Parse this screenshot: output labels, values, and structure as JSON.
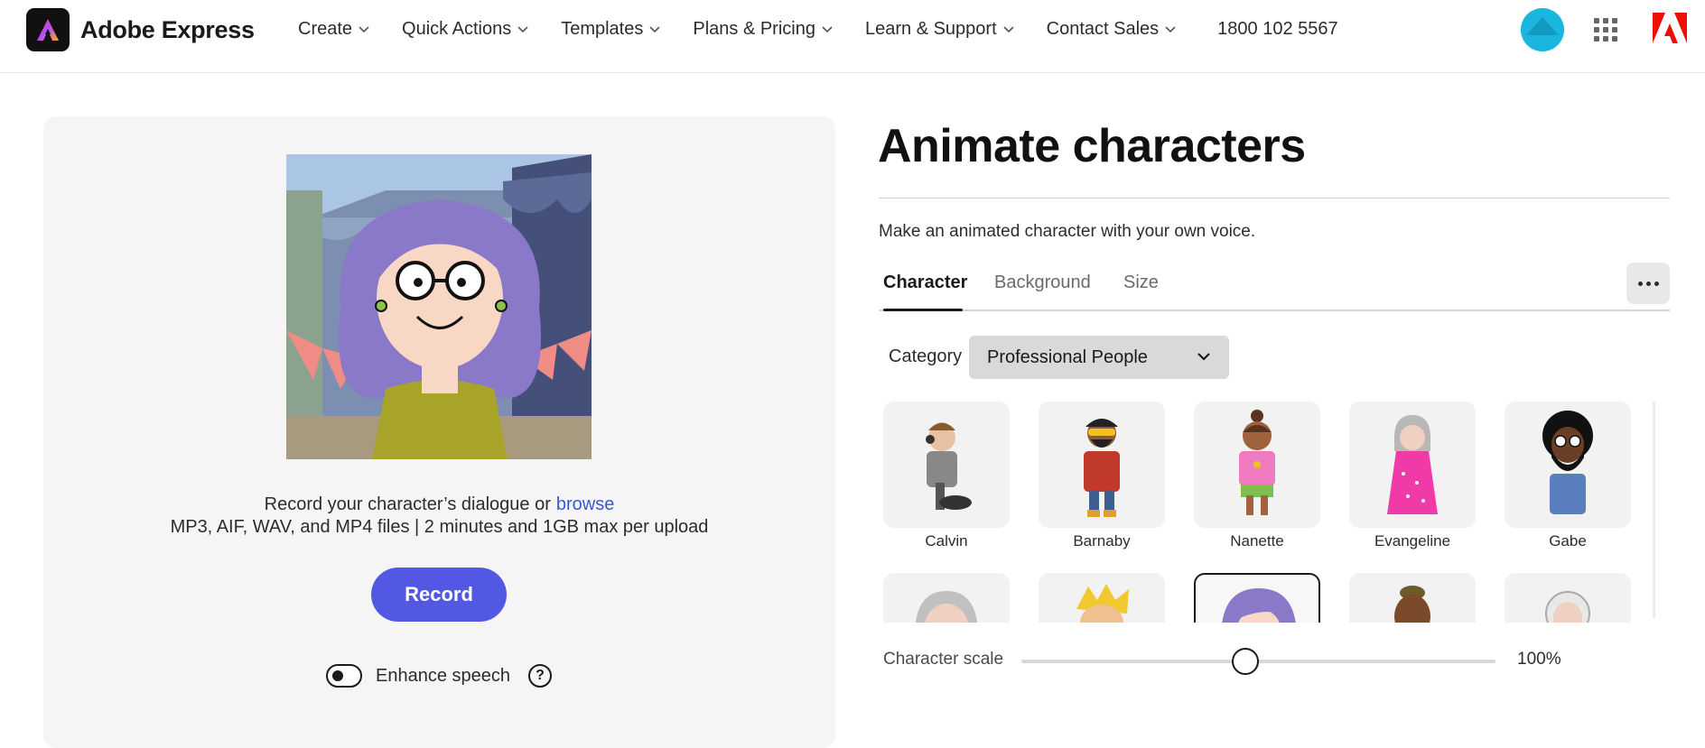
{
  "header": {
    "brand_name": "Adobe Express",
    "nav": [
      {
        "label": "Create"
      },
      {
        "label": "Quick Actions"
      },
      {
        "label": "Templates"
      },
      {
        "label": "Plans & Pricing"
      },
      {
        "label": "Learn & Support"
      },
      {
        "label": "Contact Sales"
      }
    ],
    "phone": "1800 102 5567",
    "icons": [
      "avatar",
      "apps-grid-icon",
      "adobe-logo-icon"
    ]
  },
  "left_panel": {
    "record_text": "Record your character’s dialogue or",
    "browse_link": "browse",
    "formats_text": "MP3, AIF, WAV, and MP4 files | 2 minutes and 1GB max per upload",
    "record_button": "Record",
    "enhance_label": "Enhance speech",
    "help_symbol": "?",
    "enhance_enabled": false
  },
  "right_panel": {
    "title": "Animate characters",
    "subtitle": "Make an animated character with your own voice.",
    "tabs": [
      {
        "label": "Character",
        "active": true
      },
      {
        "label": "Background",
        "active": false
      },
      {
        "label": "Size",
        "active": false
      }
    ],
    "category_label": "Category",
    "category_value": "Professional People",
    "characters_row1": [
      {
        "name": "Calvin"
      },
      {
        "name": "Barnaby"
      },
      {
        "name": "Nanette"
      },
      {
        "name": "Evangeline"
      },
      {
        "name": "Gabe"
      }
    ],
    "selected_character_row2_index": 2,
    "scale_label": "Character scale",
    "scale_value": "100%",
    "scale_fraction": 0.5
  },
  "colors": {
    "accent": "#5258e4",
    "link": "#3d56d4",
    "panel_bg": "#f5f5f5",
    "avatar": "#1bb6e0",
    "adobe_red": "#eb1000"
  }
}
